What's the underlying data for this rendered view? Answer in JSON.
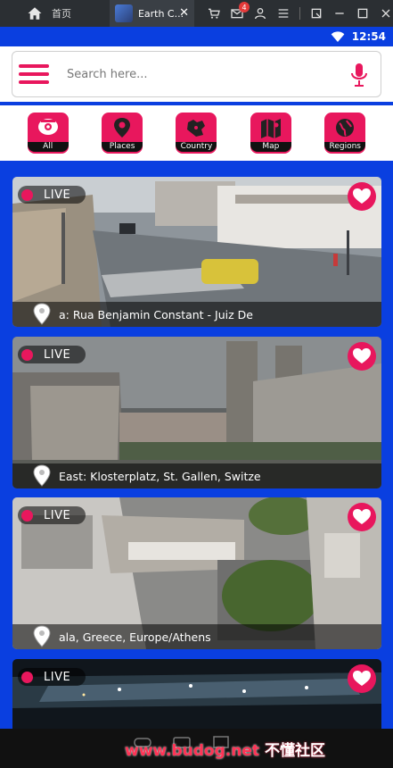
{
  "emulator": {
    "home_label": "首页",
    "tab_title": "Earth C...",
    "mail_badge": "4"
  },
  "status": {
    "time": "12:54"
  },
  "search": {
    "placeholder": "Search here..."
  },
  "categories": [
    {
      "label": "All",
      "icon": "webcam-icon"
    },
    {
      "label": "Places",
      "icon": "location-icon"
    },
    {
      "label": "Country",
      "icon": "country-map-icon"
    },
    {
      "label": "Map",
      "icon": "map-icon"
    },
    {
      "label": "Regions",
      "icon": "globe-icon"
    }
  ],
  "cameras": [
    {
      "live_label": "LIVE",
      "caption": "a: Rua Benjamin Constant - Juiz De"
    },
    {
      "live_label": "LIVE",
      "caption": "East: Klosterplatz, St. Gallen, Switze"
    },
    {
      "live_label": "LIVE",
      "caption": "ala, Greece, Europe/Athens"
    },
    {
      "live_label": "LIVE",
      "caption": ""
    }
  ],
  "watermark": {
    "site": "www.budog.net",
    "text": "不懂社区"
  },
  "colors": {
    "brand": "#e8175d",
    "background": "#0a3fe0"
  }
}
